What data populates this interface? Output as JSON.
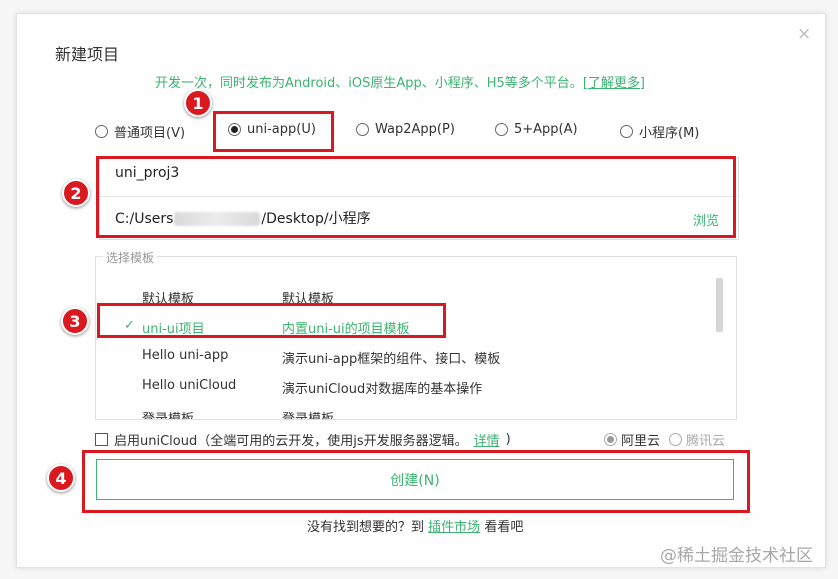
{
  "dialog": {
    "title": "新建项目",
    "close_glyph": "×",
    "subtitle": "开发一次，同时发布为Android、iOS原生App、小程序、H5等多个平台。",
    "subtitle_link": "[了解更多]"
  },
  "project_types": [
    {
      "label": "普通项目(V)",
      "selected": false
    },
    {
      "label": "uni-app(U)",
      "selected": true
    },
    {
      "label": "Wap2App(P)",
      "selected": false
    },
    {
      "label": "5+App(A)",
      "selected": false
    },
    {
      "label": "小程序(M)",
      "selected": false
    }
  ],
  "form": {
    "project_name": "uni_proj3",
    "path_prefix": "C:/Users",
    "path_suffix": "/Desktop/小程序",
    "browse_label": "浏览"
  },
  "templates": {
    "legend": "选择模板",
    "rows": [
      {
        "name": "默认模板",
        "desc": "默认模板",
        "selected": false
      },
      {
        "name": "uni-ui项目",
        "desc": "内置uni-ui的项目模板",
        "selected": true
      },
      {
        "name": "Hello uni-app",
        "desc": "演示uni-app框架的组件、接口、模板",
        "selected": false
      },
      {
        "name": "Hello uniCloud",
        "desc": "演示uniCloud对数据库的基本操作",
        "selected": false
      },
      {
        "name": "登录模板",
        "desc": "登录模板",
        "selected": false
      }
    ],
    "check_glyph": "✓"
  },
  "unicloud": {
    "label": "启用uniCloud（全端可用的云开发，使用js开发服务器逻辑。",
    "detail_link": "详情",
    "close_paren": ")",
    "checked": false,
    "providers": [
      {
        "label": "阿里云",
        "selected": true
      },
      {
        "label": "腾讯云",
        "selected": false
      }
    ]
  },
  "create_button": "创建(N)",
  "footer": {
    "prefix": "没有找到想要的？到",
    "link": "插件市场",
    "suffix": "看看吧"
  },
  "annotations": {
    "badge1": "1",
    "badge2": "2",
    "badge3": "3",
    "badge4": "4"
  },
  "watermark": "@稀土掘金技术社区",
  "colors": {
    "accent_green": "#3cb371",
    "annotation_red": "#d9181f"
  }
}
